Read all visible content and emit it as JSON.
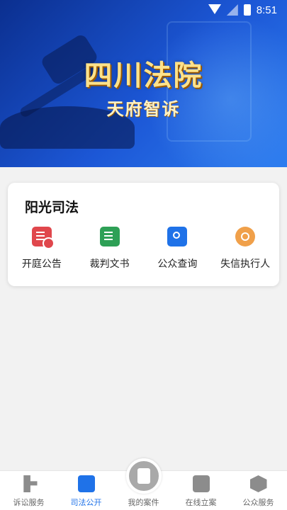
{
  "status_bar": {
    "time": "8:51"
  },
  "banner": {
    "title": "四川法院",
    "subtitle": "天府智诉"
  },
  "card": {
    "title": "阳光司法",
    "items": [
      {
        "label": "开庭公告",
        "icon": "court-notice-icon",
        "color": "#e0474c"
      },
      {
        "label": "裁判文书",
        "icon": "judgment-document-icon",
        "color": "#2ea056"
      },
      {
        "label": "公众查询",
        "icon": "search-icon",
        "color": "#1f72e8"
      },
      {
        "label": "失信执行人",
        "icon": "dishonest-person-icon",
        "color": "#f0a04a"
      }
    ]
  },
  "bottom_nav": {
    "items": [
      {
        "label": "诉讼服务",
        "icon": "gavel-icon",
        "active": false
      },
      {
        "label": "司法公开",
        "icon": "publicity-icon",
        "active": true
      },
      {
        "label": "我的案件",
        "icon": "my-case-icon",
        "active": false
      },
      {
        "label": "在线立案",
        "icon": "online-filing-icon",
        "active": false
      },
      {
        "label": "公众服务",
        "icon": "public-service-icon",
        "active": false
      }
    ]
  },
  "colors": {
    "accent": "#1f72e8",
    "banner_title": "#ffe28a"
  }
}
